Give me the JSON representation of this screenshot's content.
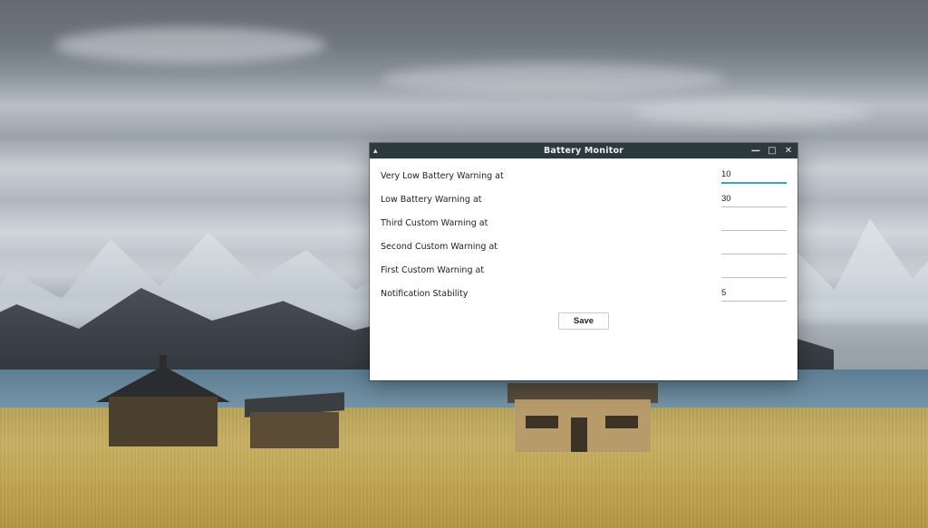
{
  "window": {
    "title": "Battery Monitor",
    "controls": {
      "minimize_glyph": "—",
      "maximize_glyph": "□",
      "close_glyph": "✕",
      "menu_arrow_glyph": "▴"
    }
  },
  "fields": [
    {
      "label": "Very Low Battery Warning at",
      "value": "10",
      "focused": true
    },
    {
      "label": "Low Battery Warning at",
      "value": "30",
      "focused": false
    },
    {
      "label": "Third Custom Warning at",
      "value": "",
      "focused": false
    },
    {
      "label": "Second Custom Warning at",
      "value": "",
      "focused": false
    },
    {
      "label": "First Custom Warning at",
      "value": "",
      "focused": false
    },
    {
      "label": "Notification Stability",
      "value": "5",
      "focused": false
    }
  ],
  "buttons": {
    "save": "Save"
  }
}
